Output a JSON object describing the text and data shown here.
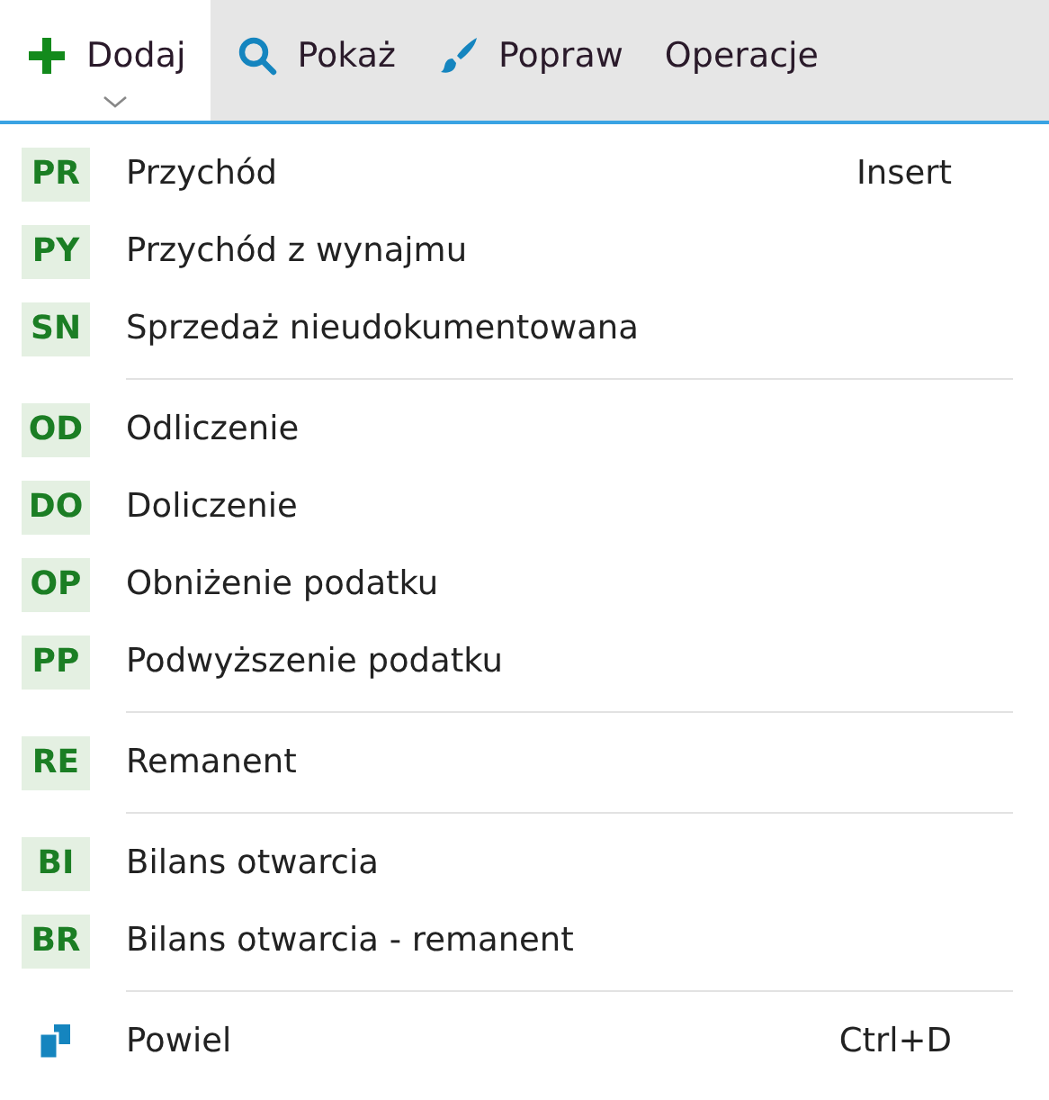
{
  "toolbar": [
    {
      "kind": "add",
      "label": "Dodaj",
      "selected": true
    },
    {
      "kind": "search",
      "label": "Pokaż",
      "selected": false
    },
    {
      "kind": "brush",
      "label": "Popraw",
      "selected": false
    },
    {
      "kind": "plain",
      "label": "Operacje",
      "selected": false
    }
  ],
  "menu": {
    "groups": [
      [
        {
          "kind": "code",
          "code": "PR",
          "label": "Przychód",
          "shortcut": "Insert"
        },
        {
          "kind": "code",
          "code": "PY",
          "label": "Przychód z wynajmu"
        },
        {
          "kind": "code",
          "code": "SN",
          "label": "Sprzedaż nieudokumentowana"
        }
      ],
      [
        {
          "kind": "code",
          "code": "OD",
          "label": "Odliczenie"
        },
        {
          "kind": "code",
          "code": "DO",
          "label": "Doliczenie"
        },
        {
          "kind": "code",
          "code": "OP",
          "label": "Obniżenie podatku"
        },
        {
          "kind": "code",
          "code": "PP",
          "label": "Podwyższenie podatku"
        }
      ],
      [
        {
          "kind": "code",
          "code": "RE",
          "label": "Remanent"
        }
      ],
      [
        {
          "kind": "code",
          "code": "BI",
          "label": "Bilans otwarcia"
        },
        {
          "kind": "code",
          "code": "BR",
          "label": "Bilans otwarcia - remanent"
        }
      ],
      [
        {
          "kind": "copy",
          "label": "Powiel",
          "shortcut": "Ctrl+D"
        }
      ]
    ]
  }
}
